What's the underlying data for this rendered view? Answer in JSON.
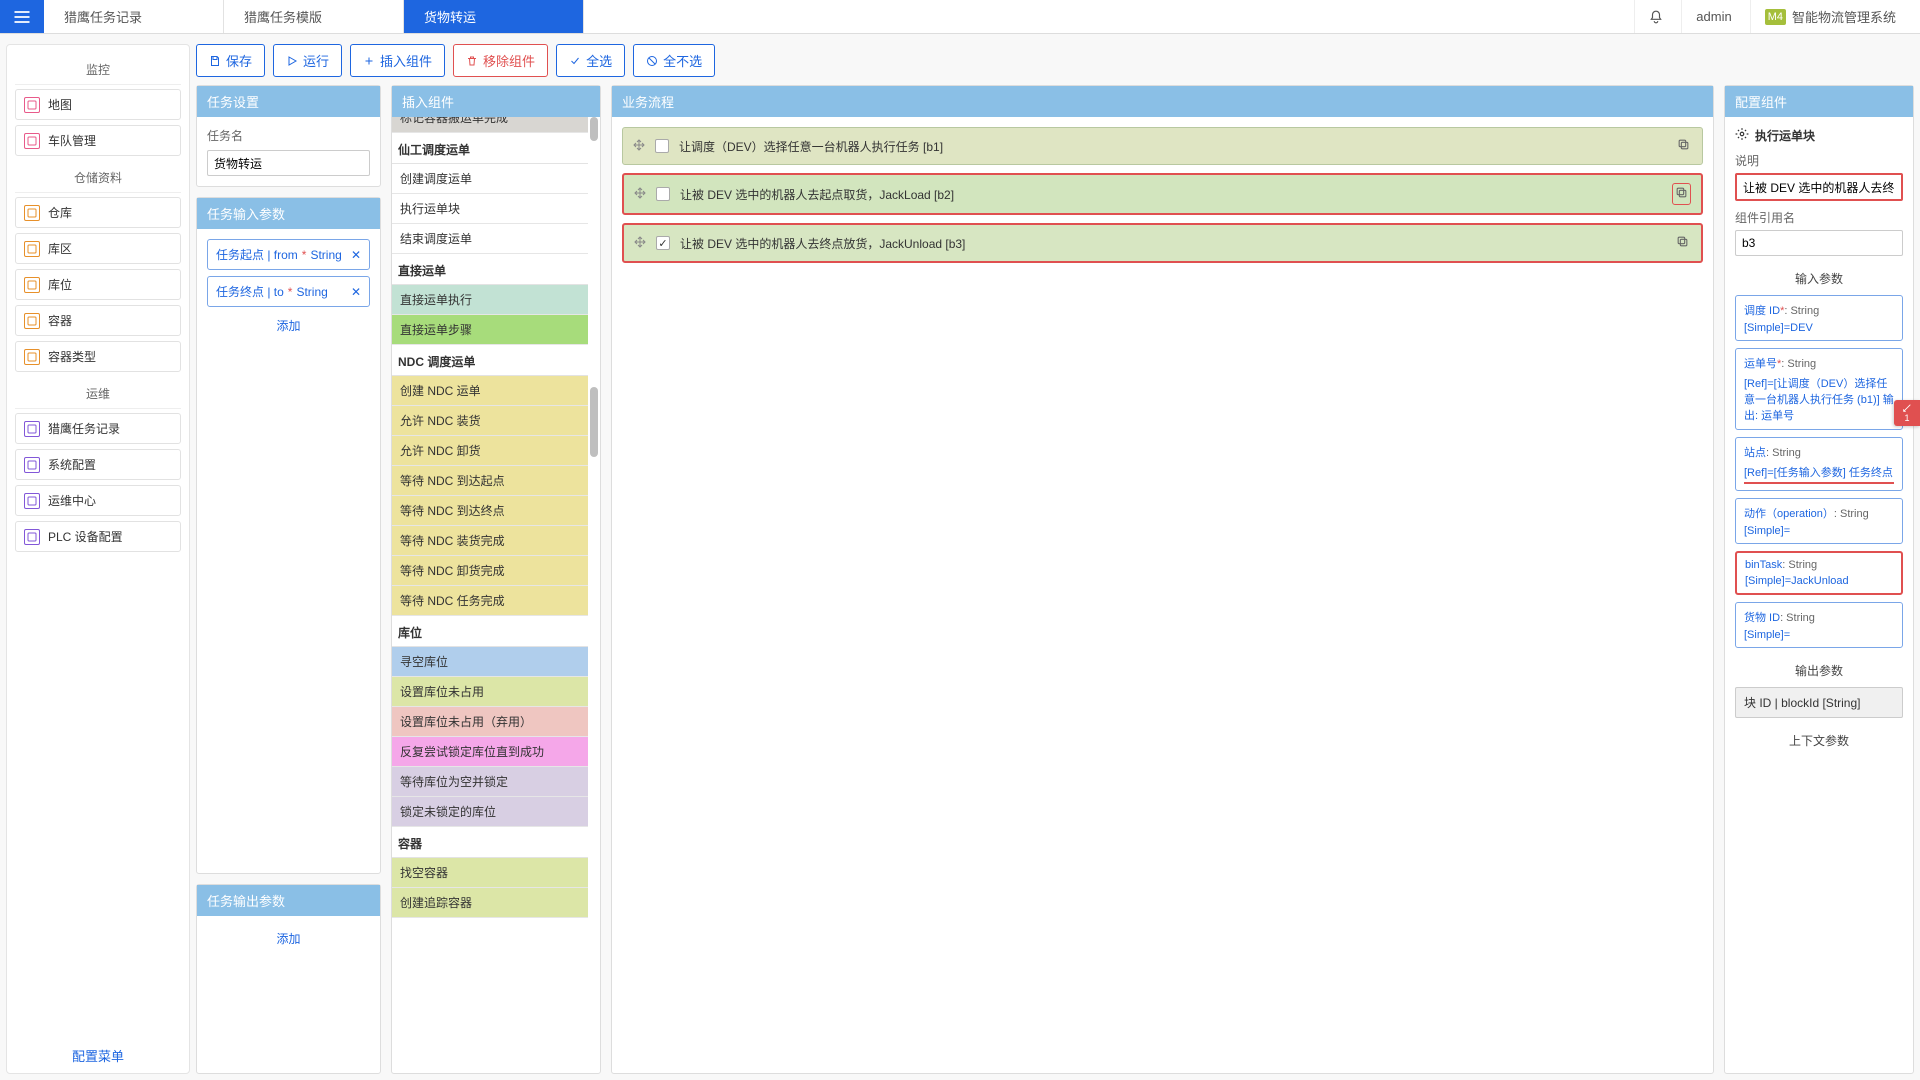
{
  "header": {
    "tabs": [
      "猎鹰任务记录",
      "猎鹰任务模版",
      "货物转运"
    ],
    "active_tab": 2,
    "user": "admin",
    "brand_badge": "M4",
    "brand": "智能物流管理系统"
  },
  "sidebar": {
    "groups": [
      {
        "title": "监控",
        "color": "p-pink",
        "items": [
          "地图",
          "车队管理"
        ]
      },
      {
        "title": "仓储资料",
        "color": "p-orange",
        "items": [
          "仓库",
          "库区",
          "库位",
          "容器",
          "容器类型"
        ]
      },
      {
        "title": "运维",
        "color": "p-purple",
        "items": [
          "猎鹰任务记录",
          "系统配置",
          "运维中心",
          "PLC 设备配置"
        ]
      }
    ],
    "config_menu": "配置菜单"
  },
  "toolbar": {
    "save": "保存",
    "run": "运行",
    "insert": "插入组件",
    "remove": "移除组件",
    "select_all": "全选",
    "select_none": "全不选"
  },
  "task_settings": {
    "panel_title": "任务设置",
    "name_label": "任务名",
    "name_value": "货物转运"
  },
  "task_inputs": {
    "panel_title": "任务输入参数",
    "params": [
      {
        "label": "任务起点 | from",
        "type": "String"
      },
      {
        "label": "任务终点 | to",
        "type": "String"
      }
    ],
    "add": "添加"
  },
  "task_outputs": {
    "panel_title": "任务输出参数",
    "add": "添加"
  },
  "plugins": {
    "panel_title": "插入组件",
    "top_clipped": "标记容器搬运单完成",
    "cats": [
      {
        "name": "仙工调度运单",
        "items": [
          {
            "t": "创建调度运单",
            "c": ""
          },
          {
            "t": "执行运单块",
            "c": ""
          },
          {
            "t": "结束调度运单",
            "c": ""
          }
        ]
      },
      {
        "name": "直接运单",
        "items": [
          {
            "t": "直接运单执行",
            "c": "c-teal"
          },
          {
            "t": "直接运单步骤",
            "c": "c-green"
          }
        ]
      },
      {
        "name": "NDC 调度运单",
        "items": [
          {
            "t": "创建 NDC 运单",
            "c": "c-yellow"
          },
          {
            "t": "允许 NDC 装货",
            "c": "c-yellow"
          },
          {
            "t": "允许 NDC 卸货",
            "c": "c-yellow"
          },
          {
            "t": "等待 NDC 到达起点",
            "c": "c-yellow"
          },
          {
            "t": "等待 NDC 到达终点",
            "c": "c-yellow"
          },
          {
            "t": "等待 NDC 装货完成",
            "c": "c-yellow"
          },
          {
            "t": "等待 NDC 卸货完成",
            "c": "c-yellow"
          },
          {
            "t": "等待 NDC 任务完成",
            "c": "c-yellow"
          }
        ]
      },
      {
        "name": "库位",
        "items": [
          {
            "t": "寻空库位",
            "c": "c-blue"
          },
          {
            "t": "设置库位未占用",
            "c": "c-olive"
          },
          {
            "t": "设置库位未占用（弃用）",
            "c": "c-pink"
          },
          {
            "t": "反复尝试锁定库位直到成功",
            "c": "c-mag"
          },
          {
            "t": "等待库位为空并锁定",
            "c": "c-lav"
          },
          {
            "t": "锁定未锁定的库位",
            "c": "c-lav"
          }
        ]
      },
      {
        "name": "容器",
        "items": [
          {
            "t": "找空容器",
            "c": "c-olive"
          },
          {
            "t": "创建追踪容器",
            "c": "c-olive"
          }
        ]
      }
    ]
  },
  "flow": {
    "panel_title": "业务流程",
    "items": [
      {
        "text": "让调度（DEV）选择任意一台机器人执行任务 [b1]",
        "checked": false,
        "cls": "flow-a",
        "red": false
      },
      {
        "text": "让被 DEV 选中的机器人去起点取货，JackLoad [b2]",
        "checked": false,
        "cls": "flow-b",
        "red": true,
        "copy_red": true
      },
      {
        "text": "让被 DEV 选中的机器人去终点放货，JackUnload [b3]",
        "checked": true,
        "cls": "flow-c",
        "red": true
      }
    ]
  },
  "config": {
    "panel_title": "配置组件",
    "component_icon_title": "执行运单块",
    "desc_label": "说明",
    "desc_value": "让被 DEV 选中的机器人去终点放货",
    "ref_label": "组件引用名",
    "ref_value": "b3",
    "input_section": "输入参数",
    "inputs": [
      {
        "name": "调度 ID",
        "req": true,
        "type": "String",
        "val": "[Simple]=DEV"
      },
      {
        "name": "运单号",
        "req": true,
        "type": "String",
        "val": "[Ref]=[让调度（DEV）选择任意一台机器人执行任务 (b1)] 输出: 运单号"
      },
      {
        "name": "站点",
        "req": false,
        "type": "String",
        "val": "[Ref]=[任务输入参数] 任务终点",
        "redval": true
      },
      {
        "name": "动作（operation）",
        "req": false,
        "type": "String",
        "val": "[Simple]="
      },
      {
        "name": "binTask",
        "req": false,
        "type": "String",
        "val": "[Simple]=JackUnload",
        "redbox": true
      },
      {
        "name": "货物 ID",
        "req": false,
        "type": "String",
        "val": "[Simple]="
      }
    ],
    "output_section": "输出参数",
    "outputs": [
      "块 ID | blockId [String]"
    ],
    "context_section": "上下文参数"
  },
  "float_badge": "1"
}
